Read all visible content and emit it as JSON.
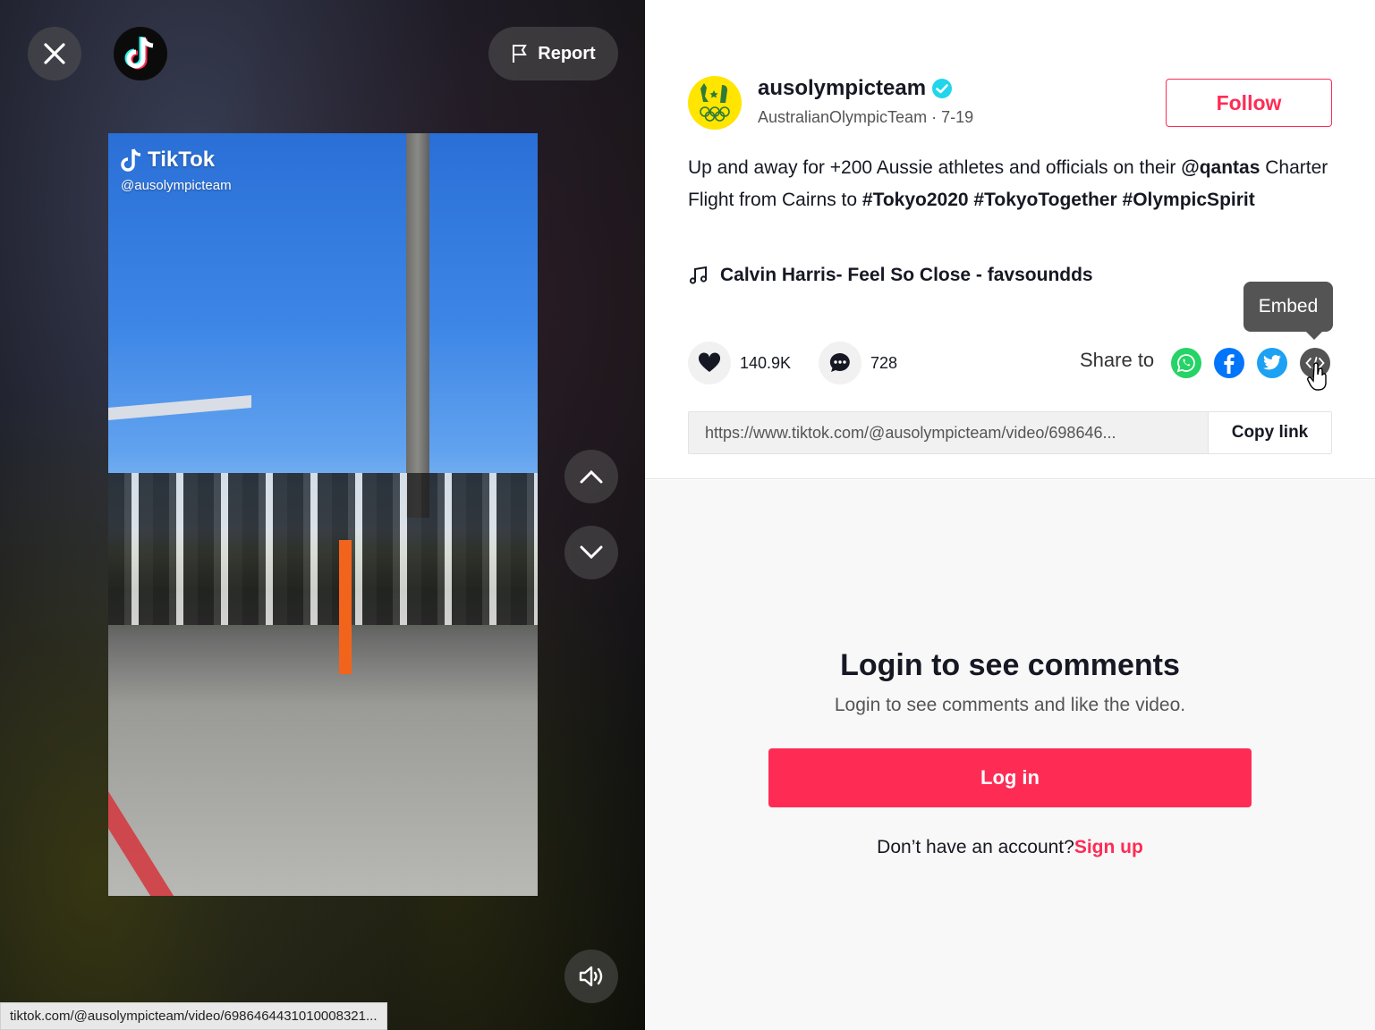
{
  "header": {
    "report_label": "Report"
  },
  "video": {
    "watermark_brand": "TikTok",
    "watermark_handle": "@ausolympicteam"
  },
  "status_bar_url": "tiktok.com/@ausolympicteam/video/6986464431010008321...",
  "author": {
    "username": "ausolympicteam",
    "nickname": "AustralianOlympicTeam",
    "date": "7-19",
    "separator": " · ",
    "follow_label": "Follow"
  },
  "caption": {
    "text_1": "Up and away for +200 Aussie athletes and officials on their ",
    "mention": "@qantas",
    "text_2": " Charter Flight from Cairns to ",
    "tags": [
      "#Tokyo2020",
      "#TokyoTogether",
      "#OlympicSpirit"
    ]
  },
  "music": "Calvin Harris- Feel So Close - favsoundds",
  "stats": {
    "likes": "140.9K",
    "comments": "728"
  },
  "share": {
    "label": "Share to",
    "tooltip": "Embed",
    "link": "https://www.tiktok.com/@ausolympicteam/video/698646...",
    "copy_label": "Copy link"
  },
  "comments_gate": {
    "title": "Login to see comments",
    "subtitle": "Login to see comments and like the video.",
    "login_label": "Log in",
    "signup_prompt": "Don’t have an account?",
    "signup_label": "Sign up"
  },
  "colors": {
    "accent": "#fe2c55",
    "verified": "#20d5ec",
    "whatsapp": "#25d366",
    "facebook": "#0075fa",
    "twitter": "#1da1f2"
  }
}
